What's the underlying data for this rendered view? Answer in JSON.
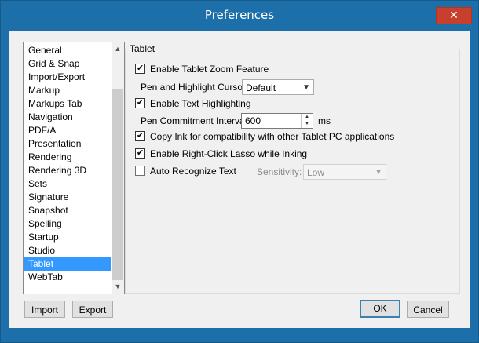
{
  "window": {
    "title": "Preferences",
    "close_glyph": "✕"
  },
  "category_list": {
    "items": [
      "General",
      "Grid & Snap",
      "Import/Export",
      "Markup",
      "Markups Tab",
      "Navigation",
      "PDF/A",
      "Presentation",
      "Rendering",
      "Rendering 3D",
      "Sets",
      "Signature",
      "Snapshot",
      "Spelling",
      "Startup",
      "Studio",
      "Tablet",
      "WebTab"
    ],
    "selected": "Tablet"
  },
  "tablet": {
    "group_title": "Tablet",
    "zoom_feature": {
      "label": "Enable Tablet Zoom Feature",
      "checked": true
    },
    "cursor": {
      "label": "Pen and Highlight Cursor:",
      "value": "Default"
    },
    "text_highlighting": {
      "label": "Enable Text Highlighting",
      "checked": true
    },
    "commitment": {
      "label": "Pen Commitment Interval:",
      "value": "600",
      "unit": "ms"
    },
    "copy_ink": {
      "label": "Copy Ink for compatibility with other Tablet PC applications",
      "checked": true
    },
    "right_click_lasso": {
      "label": "Enable Right-Click Lasso while Inking",
      "checked": true
    },
    "auto_recognize": {
      "label": "Auto Recognize Text",
      "checked": false
    },
    "sensitivity": {
      "label": "Sensitivity:",
      "value": "Low"
    }
  },
  "buttons": {
    "import": "Import",
    "export": "Export",
    "ok": "OK",
    "cancel": "Cancel"
  },
  "colors": {
    "titlebar": "#1c6fa8",
    "selection": "#3399ff",
    "close": "#c7402d"
  }
}
